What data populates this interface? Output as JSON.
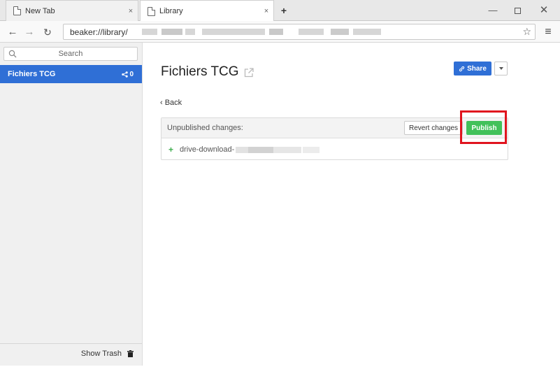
{
  "tabs": [
    {
      "title": "New Tab",
      "close": "×"
    },
    {
      "title": "Library",
      "close": "×"
    }
  ],
  "new_tab_glyph": "+",
  "window_controls": {
    "minimize": "—",
    "close": "✕"
  },
  "navbar": {
    "back": "←",
    "forward": "→",
    "reload": "↻",
    "url": "beaker://library/",
    "bookmark": "☆",
    "menu": "≡"
  },
  "sidebar": {
    "search_placeholder": "Search",
    "items": [
      {
        "name": "Fichiers TCG",
        "peers": "0"
      }
    ],
    "show_trash": "Show Trash"
  },
  "main": {
    "title": "Fichiers TCG",
    "share_label": "Share",
    "back_label": "‹ Back",
    "changes_label": "Unpublished changes:",
    "revert_label": "Revert changes",
    "publish_label": "Publish",
    "changes": [
      {
        "marker": "+",
        "name": "drive-download-"
      }
    ]
  },
  "colors": {
    "accent": "#2f6fd6",
    "publish": "#42c15a",
    "highlight": "#e0141e"
  }
}
